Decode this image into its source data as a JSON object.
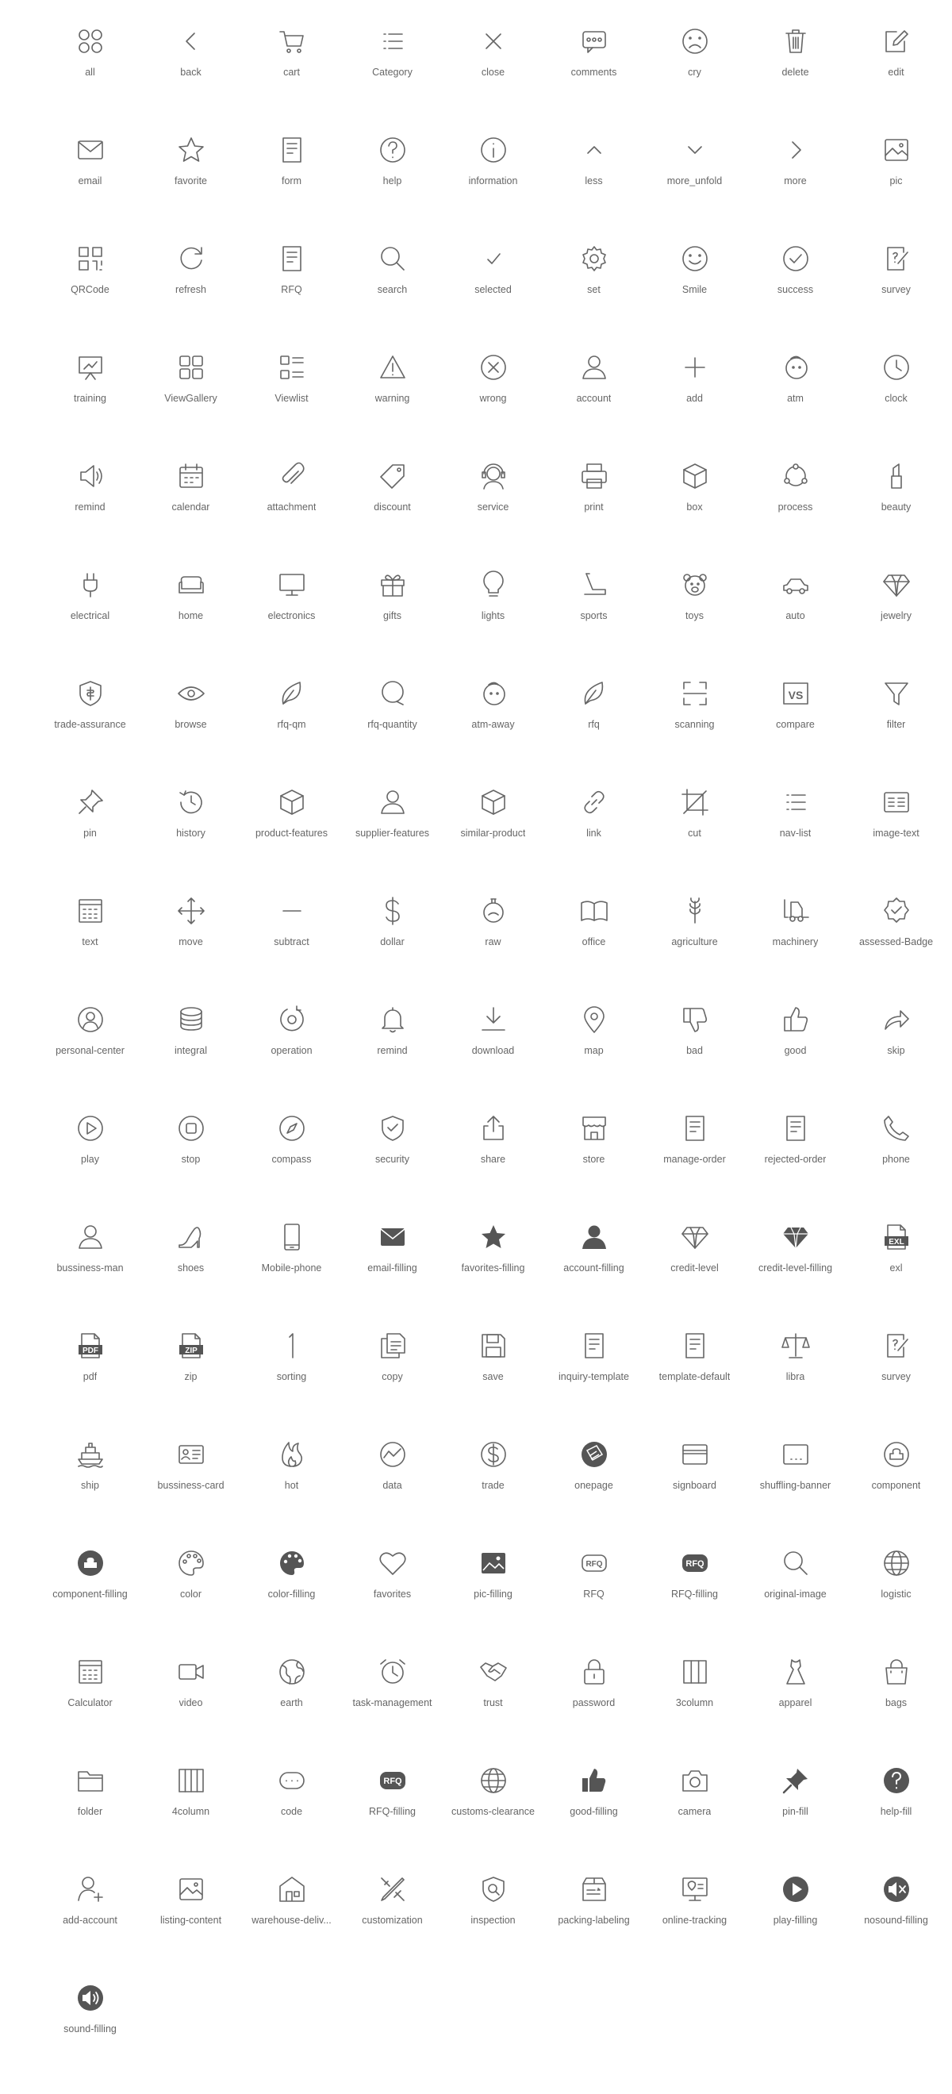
{
  "theme": {
    "icon_stroke": "#666666",
    "icon_fill": "#555555",
    "label_color": "#666666"
  },
  "icons": [
    {
      "label": "all",
      "name": "all-icon",
      "shape": "all"
    },
    {
      "label": "back",
      "name": "back-icon",
      "shape": "back"
    },
    {
      "label": "cart",
      "name": "cart-icon",
      "shape": "cart"
    },
    {
      "label": "Category",
      "name": "category-icon",
      "shape": "list"
    },
    {
      "label": "close",
      "name": "close-icon",
      "shape": "close"
    },
    {
      "label": "comments",
      "name": "comments-icon",
      "shape": "comments"
    },
    {
      "label": "cry",
      "name": "cry-icon",
      "shape": "cry"
    },
    {
      "label": "delete",
      "name": "delete-icon",
      "shape": "trash"
    },
    {
      "label": "edit",
      "name": "edit-icon",
      "shape": "edit"
    },
    {
      "label": "email",
      "name": "email-icon",
      "shape": "mail"
    },
    {
      "label": "favorite",
      "name": "favorite-icon",
      "shape": "star"
    },
    {
      "label": "form",
      "name": "form-icon",
      "shape": "doc"
    },
    {
      "label": "help",
      "name": "help-icon",
      "shape": "help"
    },
    {
      "label": "information",
      "name": "information-icon",
      "shape": "info"
    },
    {
      "label": "less",
      "name": "less-icon",
      "shape": "up"
    },
    {
      "label": "more_unfold",
      "name": "more-unfold-icon",
      "shape": "down"
    },
    {
      "label": "more",
      "name": "more-icon",
      "shape": "right"
    },
    {
      "label": "pic",
      "name": "pic-icon",
      "shape": "pic"
    },
    {
      "label": "QRCode",
      "name": "qrcode-icon",
      "shape": "qr"
    },
    {
      "label": "refresh",
      "name": "refresh-icon",
      "shape": "refresh"
    },
    {
      "label": "RFQ",
      "name": "rfq-icon",
      "shape": "doc"
    },
    {
      "label": "search",
      "name": "search-icon",
      "shape": "search"
    },
    {
      "label": "selected",
      "name": "selected-icon",
      "shape": "check"
    },
    {
      "label": "set",
      "name": "set-icon",
      "shape": "gear"
    },
    {
      "label": "Smile",
      "name": "smile-icon",
      "shape": "smile"
    },
    {
      "label": "success",
      "name": "success-icon",
      "shape": "checkcircle"
    },
    {
      "label": "survey",
      "name": "survey-icon",
      "shape": "survey"
    },
    {
      "label": "training",
      "name": "training-icon",
      "shape": "training"
    },
    {
      "label": "ViewGallery",
      "name": "view-gallery-icon",
      "shape": "gallery"
    },
    {
      "label": "Viewlist",
      "name": "viewlist-icon",
      "shape": "viewlist"
    },
    {
      "label": "warning",
      "name": "warning-icon",
      "shape": "warning"
    },
    {
      "label": "wrong",
      "name": "wrong-icon",
      "shape": "wrong"
    },
    {
      "label": "account",
      "name": "account-icon",
      "shape": "person"
    },
    {
      "label": "add",
      "name": "add-icon",
      "shape": "plus"
    },
    {
      "label": "atm",
      "name": "atm-icon",
      "shape": "atm"
    },
    {
      "label": "clock",
      "name": "clock-icon",
      "shape": "clock"
    },
    {
      "label": "remind",
      "name": "remind-speaker-icon",
      "shape": "speaker"
    },
    {
      "label": "calendar",
      "name": "calendar-icon",
      "shape": "calendar"
    },
    {
      "label": "attachment",
      "name": "attachment-icon",
      "shape": "clip"
    },
    {
      "label": "discount",
      "name": "discount-icon",
      "shape": "tag"
    },
    {
      "label": "service",
      "name": "service-icon",
      "shape": "headset"
    },
    {
      "label": "print",
      "name": "print-icon",
      "shape": "printer"
    },
    {
      "label": "box",
      "name": "box-icon",
      "shape": "box"
    },
    {
      "label": "process",
      "name": "process-icon",
      "shape": "process"
    },
    {
      "label": "beauty",
      "name": "beauty-icon",
      "shape": "lipstick"
    },
    {
      "label": "electrical",
      "name": "electrical-icon",
      "shape": "plug"
    },
    {
      "label": "home",
      "name": "home-icon",
      "shape": "sofa"
    },
    {
      "label": "electronics",
      "name": "electronics-icon",
      "shape": "monitor"
    },
    {
      "label": "gifts",
      "name": "gifts-icon",
      "shape": "gift"
    },
    {
      "label": "lights",
      "name": "lights-icon",
      "shape": "bulb"
    },
    {
      "label": "sports",
      "name": "sports-icon",
      "shape": "treadmill"
    },
    {
      "label": "toys",
      "name": "toys-icon",
      "shape": "bear"
    },
    {
      "label": "auto",
      "name": "auto-icon",
      "shape": "car"
    },
    {
      "label": "jewelry",
      "name": "jewelry-icon",
      "shape": "diamond"
    },
    {
      "label": "trade-assurance",
      "name": "trade-assurance-icon",
      "shape": "shield"
    },
    {
      "label": "browse",
      "name": "browse-icon",
      "shape": "eye"
    },
    {
      "label": "rfq-qm",
      "name": "rfq-qm-icon",
      "shape": "leaf"
    },
    {
      "label": "rfq-quantity",
      "name": "rfq-quantity-icon",
      "shape": "bubble"
    },
    {
      "label": "atm-away",
      "name": "atm-away-icon",
      "shape": "atm"
    },
    {
      "label": "rfq",
      "name": "rfq-leaf-icon",
      "shape": "leaf"
    },
    {
      "label": "scanning",
      "name": "scanning-icon",
      "shape": "scan"
    },
    {
      "label": "compare",
      "name": "compare-icon",
      "shape": "vs"
    },
    {
      "label": "filter",
      "name": "filter-icon",
      "shape": "funnel"
    },
    {
      "label": "pin",
      "name": "pin-icon",
      "shape": "pin"
    },
    {
      "label": "history",
      "name": "history-icon",
      "shape": "history"
    },
    {
      "label": "product-features",
      "name": "product-features-icon",
      "shape": "box"
    },
    {
      "label": "supplier-features",
      "name": "supplier-features-icon",
      "shape": "person"
    },
    {
      "label": "similar-product",
      "name": "similar-product-icon",
      "shape": "box"
    },
    {
      "label": "link",
      "name": "link-icon",
      "shape": "link"
    },
    {
      "label": "cut",
      "name": "cut-icon",
      "shape": "crop"
    },
    {
      "label": "nav-list",
      "name": "nav-list-icon",
      "shape": "list"
    },
    {
      "label": "image-text",
      "name": "image-text-icon",
      "shape": "imagetext"
    },
    {
      "label": "text",
      "name": "text-icon",
      "shape": "textdoc"
    },
    {
      "label": "move",
      "name": "move-icon",
      "shape": "move"
    },
    {
      "label": "subtract",
      "name": "subtract-icon",
      "shape": "minus"
    },
    {
      "label": "dollar",
      "name": "dollar-icon",
      "shape": "dollar"
    },
    {
      "label": "raw",
      "name": "raw-icon",
      "shape": "flask"
    },
    {
      "label": "office",
      "name": "office-icon",
      "shape": "book"
    },
    {
      "label": "agriculture",
      "name": "agriculture-icon",
      "shape": "wheat"
    },
    {
      "label": "machinery",
      "name": "machinery-icon",
      "shape": "forklift"
    },
    {
      "label": "assessed-Badge",
      "name": "assessed-badge-icon",
      "shape": "badge"
    },
    {
      "label": "personal-center",
      "name": "personal-center-icon",
      "shape": "personcircle"
    },
    {
      "label": "integral",
      "name": "integral-icon",
      "shape": "coins"
    },
    {
      "label": "operation",
      "name": "operation-icon",
      "shape": "operation"
    },
    {
      "label": "remind",
      "name": "remind-bell-icon",
      "shape": "bell"
    },
    {
      "label": "download",
      "name": "download-icon",
      "shape": "download"
    },
    {
      "label": "map",
      "name": "map-icon",
      "shape": "mappin"
    },
    {
      "label": "bad",
      "name": "bad-icon",
      "shape": "thumbdown"
    },
    {
      "label": "good",
      "name": "good-icon",
      "shape": "thumbup"
    },
    {
      "label": "skip",
      "name": "skip-icon",
      "shape": "skip"
    },
    {
      "label": "play",
      "name": "play-icon",
      "shape": "play"
    },
    {
      "label": "stop",
      "name": "stop-icon",
      "shape": "stop"
    },
    {
      "label": "compass",
      "name": "compass-icon",
      "shape": "compass"
    },
    {
      "label": "security",
      "name": "security-icon",
      "shape": "shieldcheck"
    },
    {
      "label": "share",
      "name": "share-icon",
      "shape": "share"
    },
    {
      "label": "store",
      "name": "store-icon",
      "shape": "store"
    },
    {
      "label": "manage-order",
      "name": "manage-order-icon",
      "shape": "doc"
    },
    {
      "label": "rejected-order",
      "name": "rejected-order-icon",
      "shape": "doc"
    },
    {
      "label": "phone",
      "name": "phone-icon",
      "shape": "phone"
    },
    {
      "label": "bussiness-man",
      "name": "bussiness-man-icon",
      "shape": "person"
    },
    {
      "label": "shoes",
      "name": "shoes-icon",
      "shape": "heel"
    },
    {
      "label": "Mobile-phone",
      "name": "mobile-phone-icon",
      "shape": "mobile"
    },
    {
      "label": "email-filling",
      "name": "email-filling-icon",
      "shape": "mailfill"
    },
    {
      "label": "favorites-filling",
      "name": "favorites-filling-icon",
      "shape": "starfill"
    },
    {
      "label": "account-filling",
      "name": "account-filling-icon",
      "shape": "personfill"
    },
    {
      "label": "credit-level",
      "name": "credit-level-icon",
      "shape": "diamond"
    },
    {
      "label": "credit-level-filling",
      "name": "credit-level-filling-icon",
      "shape": "diamondfill"
    },
    {
      "label": "exl",
      "name": "exl-icon",
      "shape": "file",
      "text": "EXL"
    },
    {
      "label": "pdf",
      "name": "pdf-icon",
      "shape": "file",
      "text": "PDF"
    },
    {
      "label": "zip",
      "name": "zip-icon",
      "shape": "file",
      "text": "ZIP"
    },
    {
      "label": "sorting",
      "name": "sorting-icon",
      "shape": "one"
    },
    {
      "label": "copy",
      "name": "copy-icon",
      "shape": "copy"
    },
    {
      "label": "save",
      "name": "save-icon",
      "shape": "save"
    },
    {
      "label": "inquiry-template",
      "name": "inquiry-template-icon",
      "shape": "doc"
    },
    {
      "label": "template-default",
      "name": "template-default-icon",
      "shape": "doc"
    },
    {
      "label": "libra",
      "name": "libra-icon",
      "shape": "scale"
    },
    {
      "label": "survey",
      "name": "survey-pen-icon",
      "shape": "survey"
    },
    {
      "label": "ship",
      "name": "ship-icon",
      "shape": "ship"
    },
    {
      "label": "bussiness-card",
      "name": "bussiness-card-icon",
      "shape": "card"
    },
    {
      "label": "hot",
      "name": "hot-icon",
      "shape": "flame"
    },
    {
      "label": "data",
      "name": "data-icon",
      "shape": "datacircle"
    },
    {
      "label": "trade",
      "name": "trade-icon",
      "shape": "dollarcircle"
    },
    {
      "label": "onepage",
      "name": "onepage-icon",
      "shape": "onepage"
    },
    {
      "label": "signboard",
      "name": "signboard-icon",
      "shape": "signboard"
    },
    {
      "label": "shuffling-banner",
      "name": "shuffling-banner-icon",
      "shape": "banner"
    },
    {
      "label": "component",
      "name": "component-icon",
      "shape": "component"
    },
    {
      "label": "component-filling",
      "name": "component-filling-icon",
      "shape": "componentfill"
    },
    {
      "label": "color",
      "name": "color-icon",
      "shape": "palette"
    },
    {
      "label": "color-filling",
      "name": "color-filling-icon",
      "shape": "palettefill"
    },
    {
      "label": "favorites",
      "name": "favorites-icon",
      "shape": "heart"
    },
    {
      "label": "pic-filling",
      "name": "pic-filling-icon",
      "shape": "picfill"
    },
    {
      "label": "RFQ",
      "name": "rfq-badge-icon",
      "shape": "rfqbadge"
    },
    {
      "label": "RFQ-filling",
      "name": "rfq-badge-filling-icon",
      "shape": "rfqbadgefill"
    },
    {
      "label": "original-image",
      "name": "original-image-icon",
      "shape": "search"
    },
    {
      "label": "logistic",
      "name": "logistic-icon",
      "shape": "globe"
    },
    {
      "label": "Calculator",
      "name": "calculator-icon",
      "shape": "textdoc"
    },
    {
      "label": "video",
      "name": "video-icon",
      "shape": "video"
    },
    {
      "label": "earth",
      "name": "earth-icon",
      "shape": "earth"
    },
    {
      "label": "task-management",
      "name": "task-management-icon",
      "shape": "alarm"
    },
    {
      "label": "trust",
      "name": "trust-icon",
      "shape": "handshake"
    },
    {
      "label": "password",
      "name": "password-icon",
      "shape": "lock"
    },
    {
      "label": "3column",
      "name": "3column-icon",
      "shape": "col3"
    },
    {
      "label": "apparel",
      "name": "apparel-icon",
      "shape": "dress"
    },
    {
      "label": "bags",
      "name": "bags-icon",
      "shape": "bag"
    },
    {
      "label": "folder",
      "name": "folder-icon",
      "shape": "folder"
    },
    {
      "label": "4column",
      "name": "4column-icon",
      "shape": "col4"
    },
    {
      "label": "code",
      "name": "code-icon",
      "shape": "code"
    },
    {
      "label": "RFQ-filling",
      "name": "rfq-filling-icon",
      "shape": "rfqbadgefill"
    },
    {
      "label": "customs-clearance",
      "name": "customs-clearance-icon",
      "shape": "globe"
    },
    {
      "label": "good-filling",
      "name": "good-filling-icon",
      "shape": "thumbupfill"
    },
    {
      "label": "camera",
      "name": "camera-icon",
      "shape": "camera"
    },
    {
      "label": "pin-fill",
      "name": "pin-fill-icon",
      "shape": "pinfill"
    },
    {
      "label": "help-fill",
      "name": "help-fill-icon",
      "shape": "helpfill"
    },
    {
      "label": "add-account",
      "name": "add-account-icon",
      "shape": "addperson"
    },
    {
      "label": "listing-content",
      "name": "listing-content-icon",
      "shape": "pic"
    },
    {
      "label": "warehouse-deliv...",
      "name": "warehouse-delivery-icon",
      "shape": "warehouse"
    },
    {
      "label": "customization",
      "name": "customization-icon",
      "shape": "tools"
    },
    {
      "label": "inspection",
      "name": "inspection-icon",
      "shape": "inspection"
    },
    {
      "label": "packing-labeling",
      "name": "packing-labeling-icon",
      "shape": "package"
    },
    {
      "label": "online-tracking",
      "name": "online-tracking-icon",
      "shape": "tracking"
    },
    {
      "label": "play-filling",
      "name": "play-filling-icon",
      "shape": "playfill"
    },
    {
      "label": "nosound-filling",
      "name": "nosound-filling-icon",
      "shape": "nosoundfill"
    },
    {
      "label": "sound-filling",
      "name": "sound-filling-icon",
      "shape": "soundfill"
    }
  ]
}
